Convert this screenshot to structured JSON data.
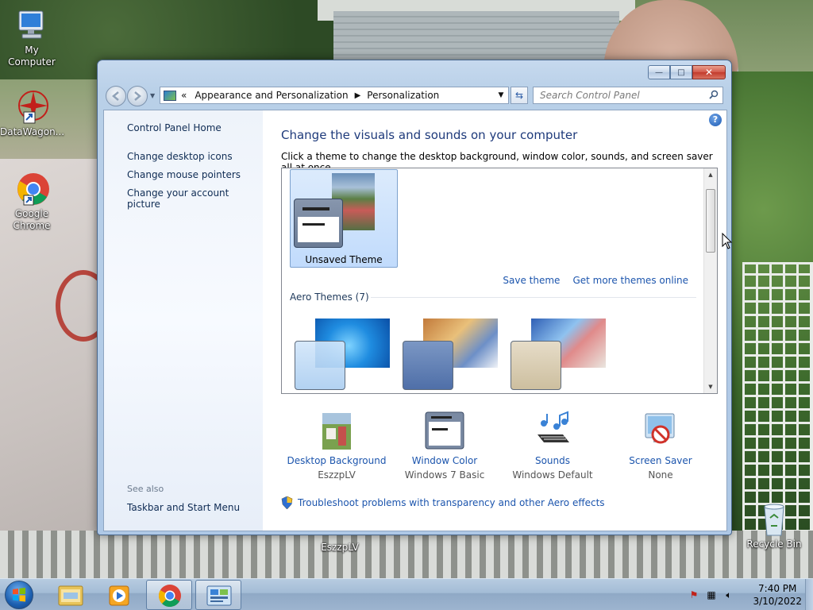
{
  "desktop": {
    "icons": [
      {
        "label": "My Computer"
      },
      {
        "label": "DataWagon..."
      },
      {
        "label": "Google Chrome"
      },
      {
        "label": "Recycle Bin"
      }
    ],
    "stray_label": "EszzpLV"
  },
  "window": {
    "buttons": {
      "minimize": "—",
      "maximize": "□",
      "close": "✕"
    },
    "address": {
      "chevron": "«",
      "crumbs": [
        "Appearance and Personalization",
        "Personalization"
      ]
    },
    "search": {
      "placeholder": "Search Control Panel"
    },
    "sidebar": {
      "home": "Control Panel Home",
      "links": [
        "Change desktop icons",
        "Change mouse pointers",
        "Change your account picture"
      ],
      "see_also": "See also",
      "see_also_links": [
        "Taskbar and Start Menu"
      ]
    },
    "main": {
      "help": "?",
      "heading": "Change the visuals and sounds on your computer",
      "subtext": "Click a theme to change the desktop background, window color, sounds, and screen saver all at once.",
      "unsaved_theme": "Unsaved Theme",
      "save_theme": "Save theme",
      "get_more": "Get more themes online",
      "group_title": "Aero Themes (7)",
      "bottom": [
        {
          "label": "Desktop Background",
          "value": "EszzpLV"
        },
        {
          "label": "Window Color",
          "value": "Windows 7 Basic"
        },
        {
          "label": "Sounds",
          "value": "Windows Default"
        },
        {
          "label": "Screen Saver",
          "value": "None"
        }
      ],
      "troubleshoot": "Troubleshoot problems with transparency and other Aero effects"
    }
  },
  "taskbar": {
    "time": "7:40 PM",
    "date": "3/10/2022"
  },
  "colors": {
    "link": "#1c55ad",
    "heading": "#1e3a7b",
    "taskbar": "#a3bcd6"
  }
}
